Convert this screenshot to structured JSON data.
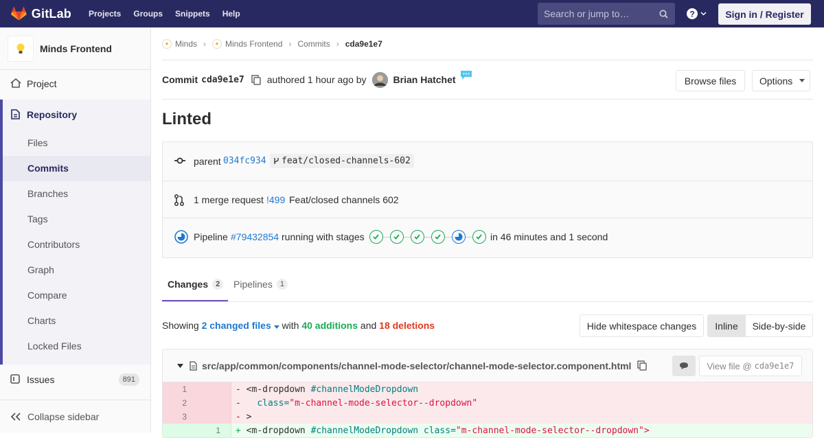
{
  "topbar": {
    "brand": "GitLab",
    "nav": [
      "Projects",
      "Groups",
      "Snippets",
      "Help"
    ],
    "search_placeholder": "Search or jump to…",
    "signin_label": "Sign in / Register",
    "colors": {
      "bar": "#292961",
      "logo": "#fc6d26"
    }
  },
  "sidebar": {
    "project_name": "Minds Frontend",
    "project": "Project",
    "repository": "Repository",
    "repo_items": [
      "Files",
      "Commits",
      "Branches",
      "Tags",
      "Contributors",
      "Graph",
      "Compare",
      "Charts",
      "Locked Files"
    ],
    "active_item": "Commits",
    "issues": "Issues",
    "issues_count": "891",
    "collapse": "Collapse sidebar"
  },
  "breadcrumbs": [
    "Minds",
    "Minds Frontend",
    "Commits",
    "cda9e1e7"
  ],
  "commit": {
    "label": "Commit",
    "sha": "cda9e1e7",
    "authored": "authored 1 hour ago by",
    "author": "Brian Hatchet",
    "browse_files": "Browse files",
    "options": "Options",
    "title": "Linted",
    "parent_label": "parent",
    "parent_sha": "034fc934",
    "branch": "feat/closed-channels-602",
    "mr_text": "1 merge request",
    "mr_id": "!499",
    "mr_title": "Feat/closed channels 602",
    "pipeline_label": "Pipeline",
    "pipeline_id": "#79432854",
    "pipeline_status": "running with stages",
    "stages": [
      "success",
      "success",
      "success",
      "success",
      "running",
      "success"
    ],
    "duration": "in 46 minutes and 1 second"
  },
  "tabs": [
    {
      "label": "Changes",
      "count": "2",
      "active": true
    },
    {
      "label": "Pipelines",
      "count": "1",
      "active": false
    }
  ],
  "diff_summary": {
    "showing": "Showing",
    "changed_files": "2 changed files",
    "with": "with",
    "additions": "40 additions",
    "and": "and",
    "deletions": "18 deletions",
    "hide_whitespace": "Hide whitespace changes",
    "inline": "Inline",
    "side_by_side": "Side-by-side"
  },
  "file": {
    "path": "src/app/common/components/channel-mode-selector/channel-mode-selector.component.html",
    "view_file": "View file @",
    "view_sha": "cda9e1e7",
    "lines": [
      {
        "type": "del",
        "old": "1",
        "new": "",
        "sign": "-",
        "tag": "<m-dropdown",
        "attr": " #channelModeDropdown",
        "rest": ""
      },
      {
        "type": "del",
        "old": "2",
        "new": "",
        "sign": "-",
        "tag": "  ",
        "attr": "class=",
        "rest": "\"m-channel-mode-selector--dropdown\""
      },
      {
        "type": "del",
        "old": "3",
        "new": "",
        "sign": "-",
        "tag": ">",
        "attr": "",
        "rest": ""
      },
      {
        "type": "add",
        "old": "",
        "new": "1",
        "sign": "+",
        "tag": "<m-dropdown",
        "attr": " #channelModeDropdown class=",
        "rest": "\"m-channel-mode-selector--dropdown\">"
      }
    ]
  }
}
